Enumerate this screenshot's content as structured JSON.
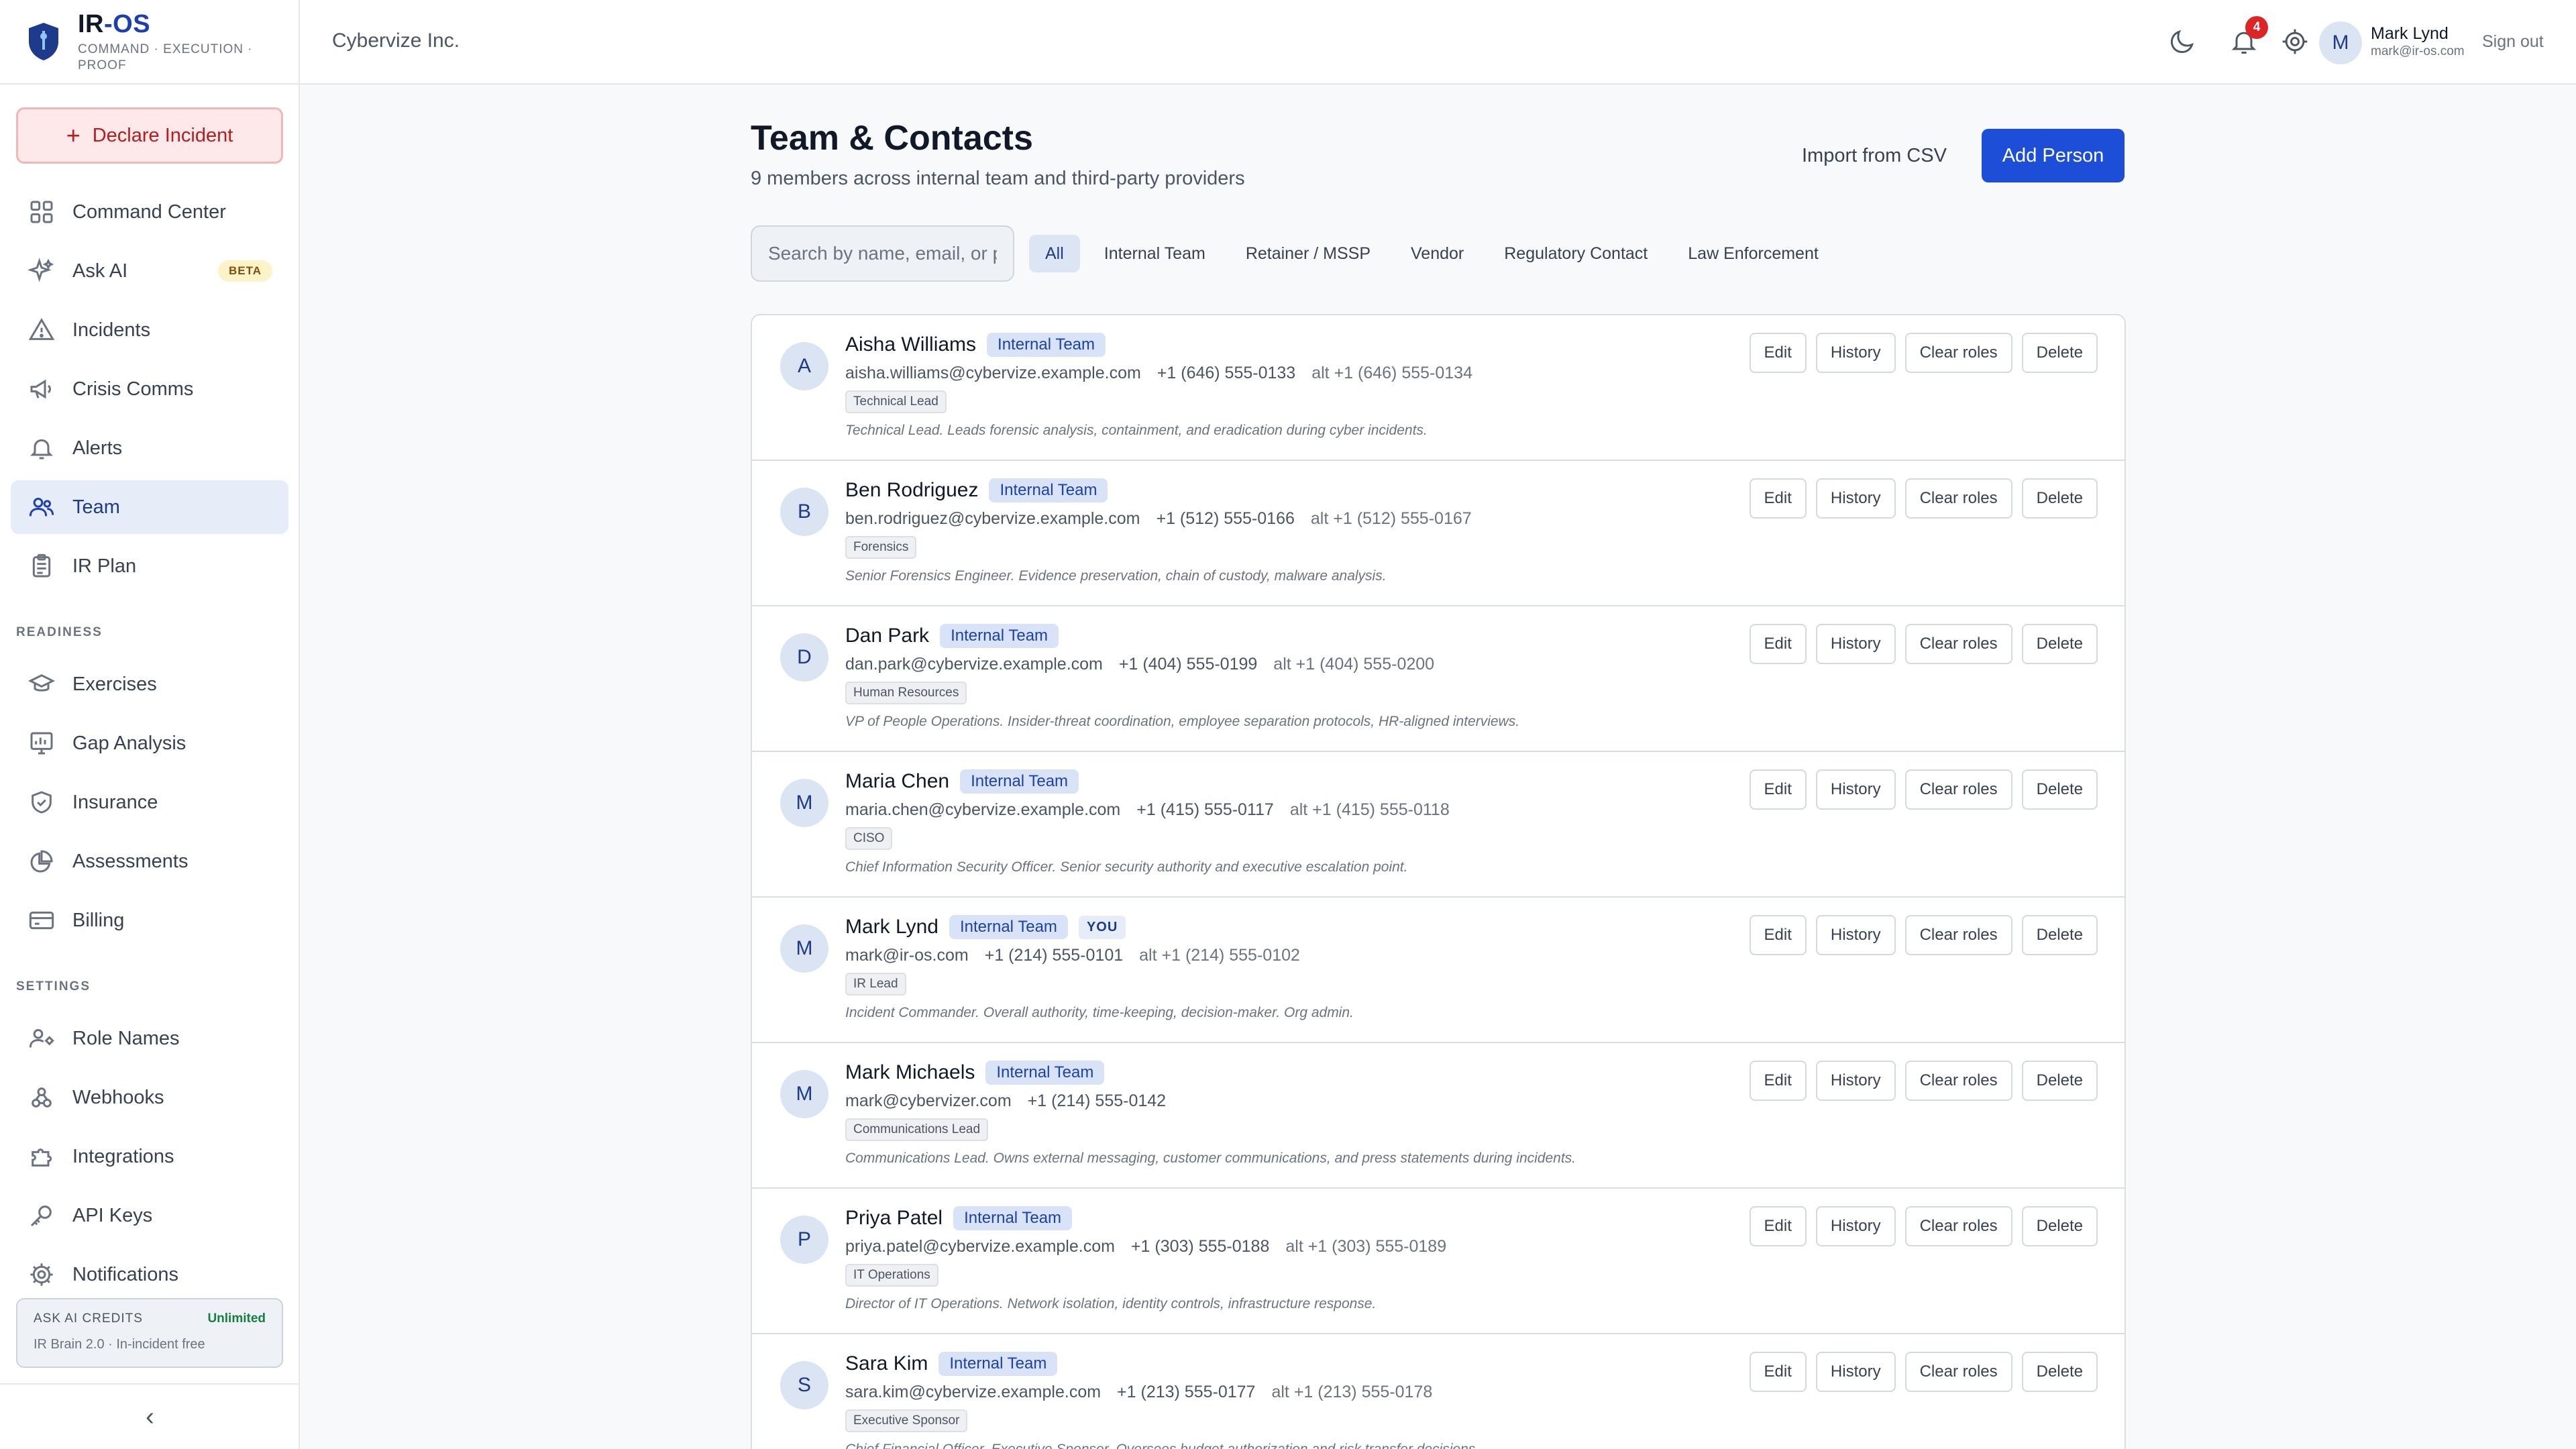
{
  "brand": {
    "name_prefix": "IR",
    "name_suffix": "-OS",
    "tagline": "COMMAND · EXECUTION · PROOF"
  },
  "sidebar": {
    "declare_label": "Declare Incident",
    "items": [
      {
        "label": "Command Center",
        "icon": "grid-icon"
      },
      {
        "label": "Ask AI",
        "icon": "sparkle-icon",
        "badge": "BETA"
      },
      {
        "label": "Incidents",
        "icon": "warning-icon"
      },
      {
        "label": "Crisis Comms",
        "icon": "megaphone-icon"
      },
      {
        "label": "Alerts",
        "icon": "bell-icon"
      },
      {
        "label": "Team",
        "icon": "users-icon",
        "active": true
      },
      {
        "label": "IR Plan",
        "icon": "clipboard-icon"
      }
    ],
    "readiness_label": "READINESS",
    "readiness_items": [
      {
        "label": "Exercises",
        "icon": "graduation-cap-icon"
      },
      {
        "label": "Gap Analysis",
        "icon": "chart-icon"
      },
      {
        "label": "Insurance",
        "icon": "shield-check-icon"
      },
      {
        "label": "Assessments",
        "icon": "pie-icon"
      },
      {
        "label": "Billing",
        "icon": "card-icon"
      }
    ],
    "settings_label": "SETTINGS",
    "settings_items": [
      {
        "label": "Role Names",
        "icon": "user-tag-icon"
      },
      {
        "label": "Webhooks",
        "icon": "webhook-icon"
      },
      {
        "label": "Integrations",
        "icon": "puzzle-icon"
      },
      {
        "label": "API Keys",
        "icon": "key-icon"
      },
      {
        "label": "Notifications",
        "icon": "gear-icon"
      }
    ],
    "credits": {
      "label": "ASK AI CREDITS",
      "value": "Unlimited",
      "sub": "IR Brain 2.0 · In-incident free"
    },
    "collapse_glyph": "‹"
  },
  "topbar": {
    "org": "Cybervize Inc.",
    "notif_count": "4",
    "avatar_initial": "M",
    "user_name": "Mark Lynd",
    "user_email": "mark@ir-os.com",
    "signout": "Sign out"
  },
  "main": {
    "title": "Team & Contacts",
    "subtitle": "9 members across internal team and third-party providers",
    "import_label": "Import from CSV",
    "add_label": "Add Person",
    "search_placeholder": "Search by name, email, or phone",
    "filters": [
      "All",
      "Internal Team",
      "Retainer / MSSP",
      "Vendor",
      "Regulatory Contact",
      "Law Enforcement"
    ],
    "active_filter": "All",
    "actions": [
      "Edit",
      "History",
      "Clear roles",
      "Delete"
    ],
    "people": [
      {
        "initial": "A",
        "name": "Aisha Williams",
        "team": "Internal Team",
        "you": "",
        "email": "aisha.williams@cybervize.example.com",
        "phone": "+1 (646) 555-0133",
        "alt": "alt +1 (646) 555-0134",
        "role": "Technical Lead",
        "desc": "Technical Lead. Leads forensic analysis, containment, and eradication during cyber incidents."
      },
      {
        "initial": "B",
        "name": "Ben Rodriguez",
        "team": "Internal Team",
        "you": "",
        "email": "ben.rodriguez@cybervize.example.com",
        "phone": "+1 (512) 555-0166",
        "alt": "alt +1 (512) 555-0167",
        "role": "Forensics",
        "desc": "Senior Forensics Engineer. Evidence preservation, chain of custody, malware analysis."
      },
      {
        "initial": "D",
        "name": "Dan Park",
        "team": "Internal Team",
        "you": "",
        "email": "dan.park@cybervize.example.com",
        "phone": "+1 (404) 555-0199",
        "alt": "alt +1 (404) 555-0200",
        "role": "Human Resources",
        "desc": "VP of People Operations. Insider-threat coordination, employee separation protocols, HR-aligned interviews."
      },
      {
        "initial": "M",
        "name": "Maria Chen",
        "team": "Internal Team",
        "you": "",
        "email": "maria.chen@cybervize.example.com",
        "phone": "+1 (415) 555-0117",
        "alt": "alt +1 (415) 555-0118",
        "role": "CISO",
        "desc": "Chief Information Security Officer. Senior security authority and executive escalation point."
      },
      {
        "initial": "M",
        "name": "Mark Lynd",
        "team": "Internal Team",
        "you": "YOU",
        "email": "mark@ir-os.com",
        "phone": "+1 (214) 555-0101",
        "alt": "alt +1 (214) 555-0102",
        "role": "IR Lead",
        "desc": "Incident Commander. Overall authority, time-keeping, decision-maker. Org admin."
      },
      {
        "initial": "M",
        "name": "Mark Michaels",
        "team": "Internal Team",
        "you": "",
        "email": "mark@cybervizer.com",
        "phone": "+1 (214) 555-0142",
        "alt": "",
        "role": "Communications Lead",
        "desc": "Communications Lead. Owns external messaging, customer communications, and press statements during incidents."
      },
      {
        "initial": "P",
        "name": "Priya Patel",
        "team": "Internal Team",
        "you": "",
        "email": "priya.patel@cybervize.example.com",
        "phone": "+1 (303) 555-0188",
        "alt": "alt +1 (303) 555-0189",
        "role": "IT Operations",
        "desc": "Director of IT Operations. Network isolation, identity controls, infrastructure response."
      },
      {
        "initial": "S",
        "name": "Sara Kim",
        "team": "Internal Team",
        "you": "",
        "email": "sara.kim@cybervize.example.com",
        "phone": "+1 (213) 555-0177",
        "alt": "alt +1 (213) 555-0178",
        "role": "Executive Sponsor",
        "desc": "Chief Financial Officer. Executive Sponsor. Oversees budget authorization and risk transfer decisions."
      }
    ]
  }
}
